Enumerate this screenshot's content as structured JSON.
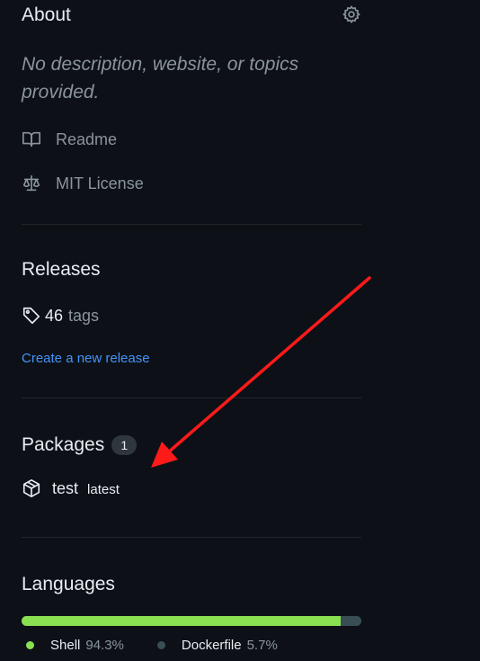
{
  "about": {
    "title": "About",
    "settings_icon": "gear-icon",
    "description": "No description, website, or topics provided.",
    "readme_label": "Readme",
    "license_label": "MIT License"
  },
  "releases": {
    "title": "Releases",
    "tags_count": "46",
    "tags_label": "tags",
    "create_link": "Create a new release"
  },
  "packages": {
    "title": "Packages",
    "count": "1",
    "items": [
      {
        "name": "test",
        "tag": "latest"
      }
    ]
  },
  "languages": {
    "title": "Languages",
    "items": [
      {
        "name": "Shell",
        "percent": "94.3%",
        "share": 94.3,
        "color": "#89e051"
      },
      {
        "name": "Dockerfile",
        "percent": "5.7%",
        "share": 5.7,
        "color": "#384d54"
      }
    ]
  },
  "annotation": {
    "arrow_color": "#ff1a1a"
  }
}
